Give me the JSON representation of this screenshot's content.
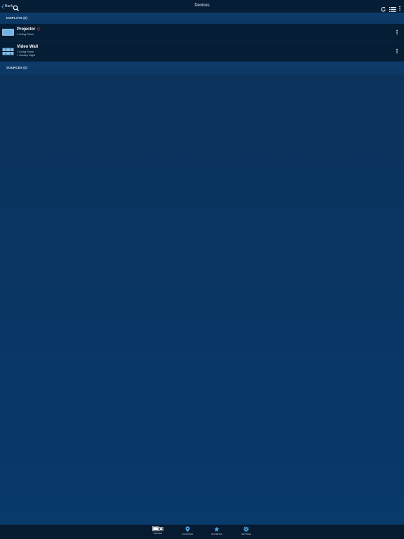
{
  "header": {
    "back_label": "Back",
    "title": "Devices"
  },
  "sections": {
    "displays": {
      "label": "DISPLAYS (2)"
    },
    "sources": {
      "label": "SOURCES (2)"
    }
  },
  "displays": [
    {
      "name": "Projector",
      "line1": "1 Living Room",
      "icon": "projector-icon",
      "status_icon": "power-off-icon"
    },
    {
      "name": "Video Wall",
      "line1": "1 Living Room",
      "line2": "> Hockey Night",
      "icon": "video-wall-icon"
    }
  ],
  "tabs": [
    {
      "label": "DEVICES",
      "icon": "devices-icon",
      "active": true
    },
    {
      "label": "LOCATIONS",
      "icon": "location-pin-icon",
      "active": false
    },
    {
      "label": "FAVORITES",
      "icon": "star-icon",
      "active": false
    },
    {
      "label": "SETTINGS",
      "icon": "gear-icon",
      "active": false
    }
  ],
  "colors": {
    "accent": "#48a8e6",
    "row_bg": "#051d35",
    "power_red": "#b0233a"
  }
}
